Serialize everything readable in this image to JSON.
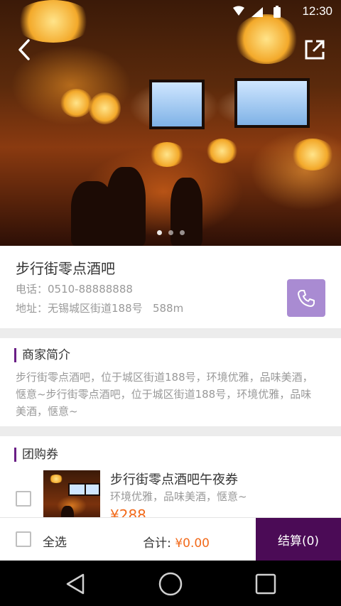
{
  "status_bar": {
    "time": "12:30"
  },
  "hero": {
    "page_indicator": {
      "count": 3,
      "active_index": 0
    }
  },
  "shop": {
    "name": "步行街零点酒吧",
    "phone": "电话：0510-88888888",
    "address": "地址：无锡城区街道188号",
    "distance": "588m"
  },
  "intro": {
    "title": "商家简介",
    "text": "步行街零点酒吧，位于城区街道188号，环境优雅，品味美酒，惬意~步行街零点酒吧，位于城区街道188号，环境优雅，品味美酒，惬意~"
  },
  "group_buy": {
    "title": "团购券",
    "items": [
      {
        "title": "步行街零点酒吧午夜券",
        "desc": "环境优雅，品味美酒，惬意~",
        "price": "¥288"
      }
    ]
  },
  "bottom_bar": {
    "select_all_label": "全选",
    "total_label": "合计:",
    "total_amount": "¥0.00",
    "checkout_label": "结算(0)"
  },
  "colors": {
    "accent": "#4b0b56",
    "call_button": "#a98bd2",
    "price": "#f26a1b"
  }
}
